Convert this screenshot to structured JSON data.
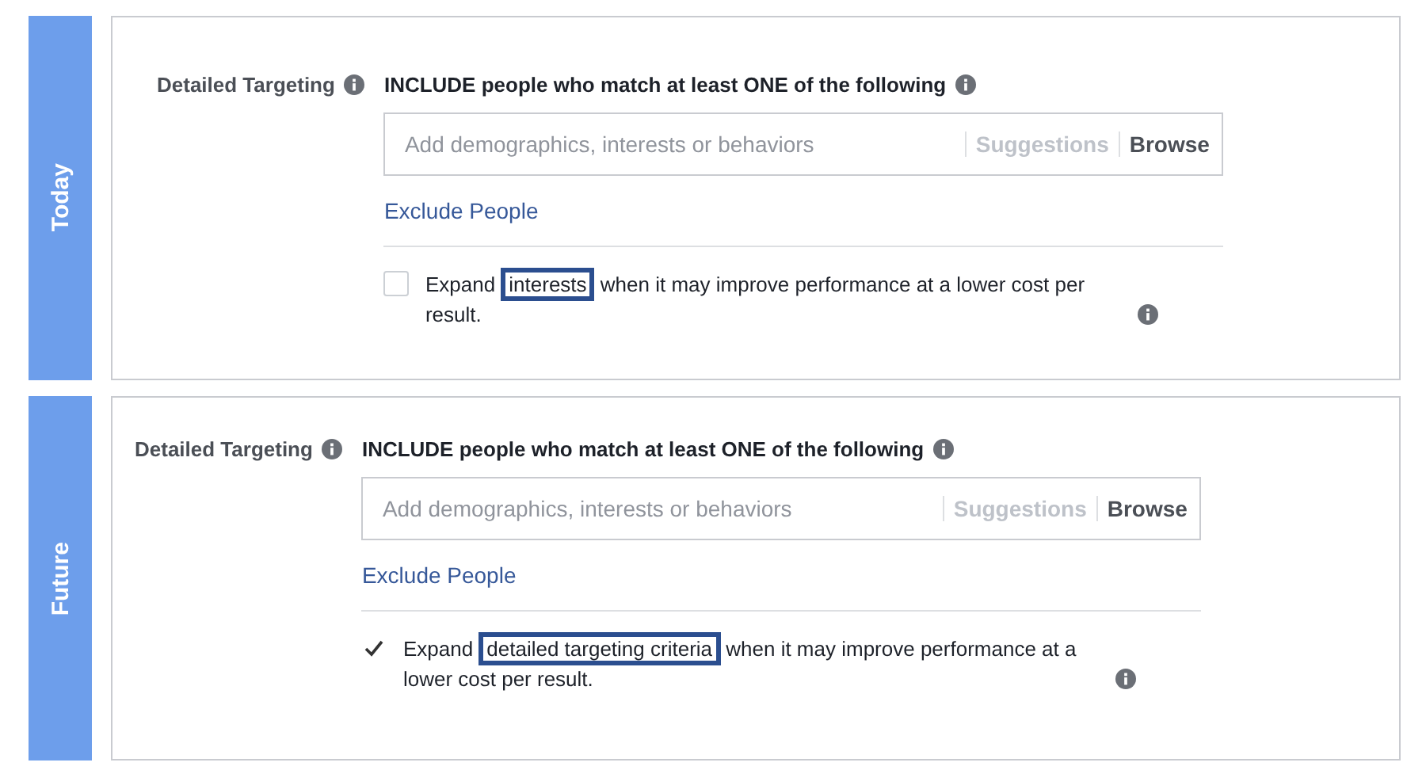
{
  "panels": [
    {
      "tag": "Today",
      "label": "Detailed Targeting",
      "heading": "INCLUDE people who match at least ONE of the following",
      "search": {
        "placeholder": "Add demographics, interests or behaviors"
      },
      "suggestions": "Suggestions",
      "browse": "Browse",
      "exclude": "Exclude People",
      "expand": {
        "checked": false,
        "before": "Expand",
        "highlight": "interests",
        "after": "when it may improve performance at a lower cost per result."
      }
    },
    {
      "tag": "Future",
      "label": "Detailed Targeting",
      "heading": "INCLUDE people who match at least ONE of the following",
      "search": {
        "placeholder": "Add demographics, interests or behaviors"
      },
      "suggestions": "Suggestions",
      "browse": "Browse",
      "exclude": "Exclude People",
      "expand": {
        "checked": true,
        "before": "Expand",
        "highlight": "detailed targeting criteria",
        "after": "when it may improve performance at a lower cost per result."
      }
    }
  ]
}
